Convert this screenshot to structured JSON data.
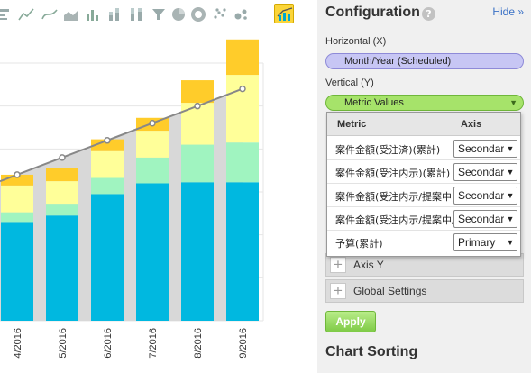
{
  "toolbar": {
    "buttons": [
      {
        "icon": "horizontal-bar-chart-icon"
      },
      {
        "icon": "line-chart-icon"
      },
      {
        "icon": "smooth-line-chart-icon"
      },
      {
        "icon": "area-chart-icon"
      },
      {
        "icon": "bar-chart-icon"
      },
      {
        "icon": "stacked-bar-chart-icon"
      },
      {
        "icon": "percent-stacked-bar-chart-icon"
      },
      {
        "icon": "funnel-chart-icon"
      },
      {
        "icon": "pie-chart-icon"
      },
      {
        "icon": "donut-chart-icon"
      },
      {
        "icon": "scatter-chart-icon"
      },
      {
        "icon": "bubble-chart-icon"
      },
      {
        "icon": "combo-chart-icon",
        "active": true
      }
    ]
  },
  "chart_data": {
    "type": "bar",
    "stacked": true,
    "categories": [
      "4/2016",
      "5/2016",
      "6/2016",
      "7/2016",
      "8/2016",
      "9/2016"
    ],
    "series": [
      {
        "values": [
          92,
          98,
          118,
          128,
          129,
          129
        ],
        "color": "#00b8e0"
      },
      {
        "values": [
          9,
          11,
          15,
          24,
          35,
          37
        ],
        "color": "#a0f4c0"
      },
      {
        "values": [
          25,
          21,
          25,
          25,
          39,
          63
        ],
        "color": "#ffff99"
      },
      {
        "values": [
          10,
          12,
          11,
          12,
          21,
          33
        ],
        "color": "#ffcc2a"
      }
    ],
    "line": {
      "values": [
        136,
        152,
        168,
        184,
        200,
        216
      ],
      "color": "#888888"
    },
    "ylim": [
      0,
      240
    ],
    "grid": true
  },
  "panel": {
    "title": "Configuration",
    "help": "?",
    "hide": "Hide »",
    "horizontal_label": "Horizontal (X)",
    "horizontal_value": "Month/Year (Scheduled)",
    "vertical_label": "Vertical (Y)",
    "vertical_value": "Metric Values",
    "axis_y": "Axis Y",
    "global_settings": "Global Settings",
    "apply": "Apply",
    "chart_sorting": "Chart Sorting"
  },
  "dropdown": {
    "col_metric": "Metric",
    "col_axis": "Axis",
    "rows": [
      {
        "metric": "案件金額(受注済)(累計)",
        "axis": "Secondary"
      },
      {
        "metric": "案件金額(受注内示)(累計)",
        "axis": "Secondary"
      },
      {
        "metric": "案件金額(受注内示/提案中)(累計)",
        "axis": "Secondary"
      },
      {
        "metric": "案件金額(受注内示/提案中/見込)(累計)",
        "axis": "Secondary"
      },
      {
        "metric": "予算(累計)",
        "axis": "Primary"
      }
    ]
  },
  "colors": {
    "accent_yellow": "#fbd53a",
    "link_blue": "#3b72c6",
    "apply_green": "#7fcb47"
  }
}
